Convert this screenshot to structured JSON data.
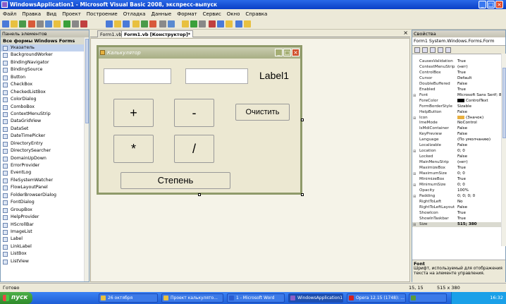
{
  "window": {
    "title": "WindowsApplication1 - Microsoft Visual Basic 2008, экспресс-выпуск",
    "min": "_",
    "max": "□",
    "close": "×"
  },
  "menu": [
    "Файл",
    "Правка",
    "Вид",
    "Проект",
    "Построение",
    "Отладка",
    "Данные",
    "Формат",
    "Сервис",
    "Окно",
    "Справка"
  ],
  "toolbox": {
    "header": "Панель элементов",
    "section": "Все формы Windows Forms",
    "items": [
      "Указатель",
      "BackgroundWorker",
      "BindingNavigator",
      "BindingSource",
      "Button",
      "CheckBox",
      "CheckedListBox",
      "ColorDialog",
      "ComboBox",
      "ContextMenuStrip",
      "DataGridView",
      "DataSet",
      "DateTimePicker",
      "DirectoryEntry",
      "DirectorySearcher",
      "DomainUpDown",
      "ErrorProvider",
      "EventLog",
      "FileSystemWatcher",
      "FlowLayoutPanel",
      "FolderBrowserDialog",
      "FontDialog",
      "GroupBox",
      "HelpProvider",
      "HScrollBar",
      "ImageList",
      "Label",
      "LinkLabel",
      "ListBox",
      "ListView"
    ]
  },
  "tabs": [
    "Form1.vb*",
    "Form1.vb [Конструктор]*"
  ],
  "tab_close": "×",
  "form": {
    "title": "Калькулятор",
    "label": "Label1",
    "buttons": {
      "plus": "+",
      "minus": "-",
      "multiply": "*",
      "divide": "/",
      "clear": "Очистить",
      "power": "Степень"
    }
  },
  "properties": {
    "header": "Свойства",
    "object": "Form1  System.Windows.Forms.Form",
    "rows": [
      {
        "n": "CausesValidation",
        "v": "True"
      },
      {
        "n": "ContextMenuStrip",
        "v": "(нет)"
      },
      {
        "n": "ControlBox",
        "v": "True"
      },
      {
        "n": "Cursor",
        "v": "Default"
      },
      {
        "n": "DoubleBuffered",
        "v": "False"
      },
      {
        "n": "Enabled",
        "v": "True"
      },
      {
        "n": "Font",
        "v": "Microsoft Sans Serif; 8",
        "exp": "⊞"
      },
      {
        "n": "ForeColor",
        "v": "ControlText",
        "swatch": "#000000"
      },
      {
        "n": "FormBorderStyle",
        "v": "Sizable"
      },
      {
        "n": "HelpButton",
        "v": "False"
      },
      {
        "n": "Icon",
        "v": "(Значок)",
        "exp": "⊞",
        "swatch": "#e8b040"
      },
      {
        "n": "ImeMode",
        "v": "NoControl"
      },
      {
        "n": "IsMdiContainer",
        "v": "False"
      },
      {
        "n": "KeyPreview",
        "v": "False"
      },
      {
        "n": "Language",
        "v": "(По умолчанию)"
      },
      {
        "n": "Localizable",
        "v": "False"
      },
      {
        "n": "Location",
        "v": "0; 0",
        "exp": "⊞"
      },
      {
        "n": "Locked",
        "v": "False"
      },
      {
        "n": "MainMenuStrip",
        "v": "(нет)"
      },
      {
        "n": "MaximizeBox",
        "v": "True"
      },
      {
        "n": "MaximumSize",
        "v": "0; 0",
        "exp": "⊞"
      },
      {
        "n": "MinimizeBox",
        "v": "True"
      },
      {
        "n": "MinimumSize",
        "v": "0; 0",
        "exp": "⊞"
      },
      {
        "n": "Opacity",
        "v": "100%"
      },
      {
        "n": "Padding",
        "v": "0; 0; 0; 0",
        "exp": "⊞"
      },
      {
        "n": "RightToLeft",
        "v": "No"
      },
      {
        "n": "RightToLeftLayout",
        "v": "False"
      },
      {
        "n": "ShowIcon",
        "v": "True"
      },
      {
        "n": "ShowInTaskbar",
        "v": "True"
      },
      {
        "n": "Size",
        "v": "515; 380",
        "exp": "⊞",
        "selected": true
      }
    ],
    "desc_title": "Font",
    "desc_text": "Шрифт, используемый для отображения текста на элементе управления."
  },
  "status": {
    "ready": "Готово",
    "pos": "15, 15",
    "size": "515 x 380"
  },
  "taskbar": {
    "start": "пуск",
    "tasks": [
      {
        "label": "26 октября",
        "color": "#e8c040"
      },
      {
        "label": "Проект калькулято...",
        "color": "#e8c040"
      },
      {
        "label": "1 - Microsoft Word",
        "color": "#2a5bd0"
      },
      {
        "label": "WindowsApplication1 ...",
        "color": "#8a5ec8"
      },
      {
        "label": "Opera 12.15 (1748): ...",
        "color": "#d02020"
      },
      {
        "label": "",
        "color": "#5a9a3a"
      }
    ],
    "clock": "16:32"
  }
}
